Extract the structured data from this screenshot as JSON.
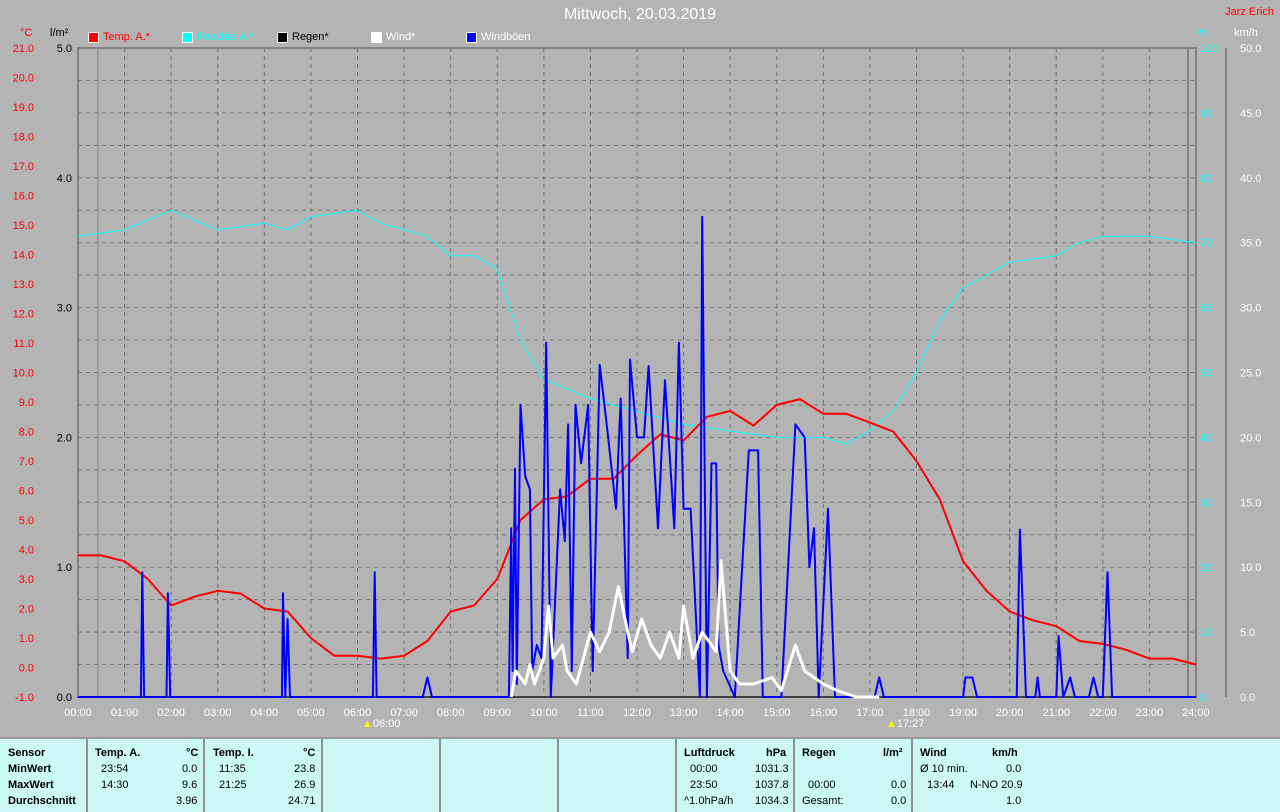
{
  "header": {
    "title": "Mittwoch, 20.03.2019",
    "owner": "Jarz Erich"
  },
  "legend": [
    {
      "label": "Temp. A.*",
      "color": "#ff0000"
    },
    {
      "label": "Feuchte A.*",
      "color": "#00ffff"
    },
    {
      "label": "Regen*",
      "color": "#000000"
    },
    {
      "label": "Wind*",
      "color": "#ffffff"
    },
    {
      "label": "Windböen",
      "color": "#0000ff"
    }
  ],
  "units": {
    "temp": "°C",
    "rain": "l/m²",
    "hum": "%",
    "wind": "km/h"
  },
  "sun": {
    "rise": "06:00",
    "set": "17:27"
  },
  "chart_data": {
    "type": "line",
    "title": "Mittwoch, 20.03.2019",
    "x_ticks": [
      "00:00",
      "01:00",
      "02:00",
      "03:00",
      "04:00",
      "05:00",
      "06:00",
      "07:00",
      "08:00",
      "09:00",
      "10:00",
      "11:00",
      "12:00",
      "13:00",
      "14:00",
      "15:00",
      "16:00",
      "17:00",
      "18:00",
      "19:00",
      "20:00",
      "21:00",
      "22:00",
      "23:00",
      "24:00"
    ],
    "xlim": [
      0,
      24
    ],
    "axes": {
      "temp": {
        "range": [
          -1,
          21
        ],
        "ticks": [
          "-1.0",
          "0.0",
          "1.0",
          "2.0",
          "3.0",
          "4.0",
          "5.0",
          "6.0",
          "7.0",
          "8.0",
          "9.0",
          "10.0",
          "11.0",
          "12.0",
          "13.0",
          "14.0",
          "15.0",
          "16.0",
          "17.0",
          "18.0",
          "19.0",
          "20.0",
          "21.0"
        ]
      },
      "rain": {
        "range": [
          0,
          5
        ],
        "ticks": [
          "0.0",
          "1.0",
          "2.0",
          "3.0",
          "4.0",
          "5.0"
        ]
      },
      "hum": {
        "range": [
          0,
          100
        ],
        "ticks": [
          "0",
          "10",
          "20",
          "30",
          "40",
          "50",
          "60",
          "70",
          "80",
          "90",
          "100"
        ]
      },
      "wind": {
        "range": [
          0,
          50
        ],
        "ticks": [
          "0.0",
          "5.0",
          "10.0",
          "15.0",
          "20.0",
          "25.0",
          "30.0",
          "35.0",
          "40.0",
          "45.0",
          "50.0"
        ]
      }
    },
    "series": [
      {
        "name": "Temp. A.",
        "axis": "temp",
        "color": "#ff0000",
        "width": 2,
        "points": [
          [
            0,
            3.8
          ],
          [
            0.5,
            3.8
          ],
          [
            1,
            3.6
          ],
          [
            1.5,
            3.0
          ],
          [
            2,
            2.1
          ],
          [
            2.5,
            2.4
          ],
          [
            3,
            2.6
          ],
          [
            3.5,
            2.5
          ],
          [
            4,
            2.0
          ],
          [
            4.5,
            1.9
          ],
          [
            5,
            1.0
          ],
          [
            5.5,
            0.4
          ],
          [
            6,
            0.4
          ],
          [
            6.5,
            0.3
          ],
          [
            7,
            0.4
          ],
          [
            7.5,
            0.9
          ],
          [
            8,
            1.9
          ],
          [
            8.5,
            2.1
          ],
          [
            9,
            3.0
          ],
          [
            9.5,
            5.0
          ],
          [
            10,
            5.7
          ],
          [
            10.5,
            5.8
          ],
          [
            11,
            6.4
          ],
          [
            11.5,
            6.4
          ],
          [
            12,
            7.2
          ],
          [
            12.5,
            7.9
          ],
          [
            13,
            7.7
          ],
          [
            13.5,
            8.5
          ],
          [
            14,
            8.7
          ],
          [
            14.5,
            8.2
          ],
          [
            15,
            8.9
          ],
          [
            15.5,
            9.1
          ],
          [
            16,
            8.6
          ],
          [
            16.5,
            8.6
          ],
          [
            17,
            8.3
          ],
          [
            17.5,
            8.0
          ],
          [
            18,
            7.0
          ],
          [
            18.5,
            5.7
          ],
          [
            19,
            3.6
          ],
          [
            19.5,
            2.6
          ],
          [
            20,
            1.9
          ],
          [
            20.5,
            1.6
          ],
          [
            21,
            1.4
          ],
          [
            21.5,
            0.9
          ],
          [
            22,
            0.8
          ],
          [
            22.5,
            0.6
          ],
          [
            23,
            0.3
          ],
          [
            23.5,
            0.3
          ],
          [
            24,
            0.1
          ]
        ]
      },
      {
        "name": "Feuchte A.",
        "axis": "hum",
        "color": "#00ffff",
        "width": 1,
        "points": [
          [
            0,
            71
          ],
          [
            1,
            72
          ],
          [
            2,
            75
          ],
          [
            3,
            72
          ],
          [
            4,
            73
          ],
          [
            4.5,
            72
          ],
          [
            5,
            74
          ],
          [
            6,
            75
          ],
          [
            6.5,
            73
          ],
          [
            7.5,
            71
          ],
          [
            8,
            68
          ],
          [
            8.5,
            68
          ],
          [
            9,
            66
          ],
          [
            9.5,
            55
          ],
          [
            10,
            49
          ],
          [
            11,
            46
          ],
          [
            12,
            44
          ],
          [
            13,
            42
          ],
          [
            14,
            41
          ],
          [
            15,
            40
          ],
          [
            16,
            40
          ],
          [
            16.5,
            39
          ],
          [
            17,
            41
          ],
          [
            17.5,
            44
          ],
          [
            18,
            50
          ],
          [
            18.5,
            58
          ],
          [
            19,
            63
          ],
          [
            20,
            67
          ],
          [
            21,
            68
          ],
          [
            21.5,
            70
          ],
          [
            22,
            71
          ],
          [
            23,
            71
          ],
          [
            24,
            70
          ]
        ]
      },
      {
        "name": "Regen",
        "axis": "rain",
        "color": "#000000",
        "width": 1,
        "points": [
          [
            0,
            0
          ],
          [
            24,
            0
          ]
        ]
      },
      {
        "name": "Windböen",
        "axis": "wind",
        "color": "#0000ff",
        "width": 2,
        "points": [
          [
            0,
            0
          ],
          [
            1.35,
            0
          ],
          [
            1.38,
            9.6
          ],
          [
            1.42,
            0
          ],
          [
            1.9,
            0
          ],
          [
            1.93,
            8
          ],
          [
            1.98,
            0
          ],
          [
            4.38,
            0
          ],
          [
            4.4,
            8
          ],
          [
            4.45,
            0
          ],
          [
            4.5,
            6
          ],
          [
            4.55,
            0
          ],
          [
            6.33,
            0
          ],
          [
            6.37,
            9.6
          ],
          [
            6.41,
            0
          ],
          [
            7.4,
            0
          ],
          [
            7.5,
            1.5
          ],
          [
            7.6,
            0
          ],
          [
            9.25,
            0
          ],
          [
            9.3,
            13
          ],
          [
            9.33,
            2
          ],
          [
            9.38,
            17.6
          ],
          [
            9.42,
            1
          ],
          [
            9.5,
            22.5
          ],
          [
            9.6,
            17
          ],
          [
            9.7,
            16
          ],
          [
            9.75,
            2
          ],
          [
            9.85,
            4
          ],
          [
            9.95,
            3
          ],
          [
            10.05,
            27.3
          ],
          [
            10.15,
            0
          ],
          [
            10.35,
            16
          ],
          [
            10.45,
            12
          ],
          [
            10.52,
            21
          ],
          [
            10.6,
            2
          ],
          [
            10.68,
            22.5
          ],
          [
            10.8,
            18
          ],
          [
            10.95,
            22.5
          ],
          [
            11.05,
            2
          ],
          [
            11.2,
            25.6
          ],
          [
            11.35,
            21
          ],
          [
            11.55,
            14.5
          ],
          [
            11.65,
            23
          ],
          [
            11.8,
            3
          ],
          [
            11.85,
            26
          ],
          [
            12.0,
            20
          ],
          [
            12.15,
            20
          ],
          [
            12.25,
            25.5
          ],
          [
            12.45,
            13
          ],
          [
            12.6,
            24.4
          ],
          [
            12.8,
            13
          ],
          [
            12.9,
            27.3
          ],
          [
            13.0,
            14.5
          ],
          [
            13.15,
            14.5
          ],
          [
            13.35,
            0
          ],
          [
            13.4,
            37
          ],
          [
            13.5,
            0
          ],
          [
            13.6,
            18
          ],
          [
            13.7,
            18
          ],
          [
            13.75,
            4
          ],
          [
            13.85,
            2
          ],
          [
            14.1,
            0
          ],
          [
            14.4,
            19
          ],
          [
            14.6,
            19
          ],
          [
            14.7,
            0
          ],
          [
            15.1,
            0
          ],
          [
            15.4,
            21
          ],
          [
            15.6,
            20
          ],
          [
            15.7,
            10
          ],
          [
            15.8,
            13
          ],
          [
            15.9,
            0
          ],
          [
            16.1,
            14.5
          ],
          [
            16.25,
            0
          ],
          [
            17.1,
            0
          ],
          [
            17.2,
            1.5
          ],
          [
            17.3,
            0
          ],
          [
            19.0,
            0
          ],
          [
            19.05,
            1.5
          ],
          [
            19.2,
            1.5
          ],
          [
            19.3,
            0
          ],
          [
            20.15,
            0
          ],
          [
            20.22,
            12.9
          ],
          [
            20.35,
            0
          ],
          [
            20.55,
            0
          ],
          [
            20.6,
            1.5
          ],
          [
            20.65,
            0
          ],
          [
            21.0,
            0
          ],
          [
            21.05,
            4.7
          ],
          [
            21.15,
            0
          ],
          [
            21.3,
            1.5
          ],
          [
            21.4,
            0
          ],
          [
            21.7,
            0
          ],
          [
            21.8,
            1.5
          ],
          [
            21.9,
            0
          ],
          [
            22.0,
            0
          ],
          [
            22.1,
            9.6
          ],
          [
            22.2,
            0
          ],
          [
            24,
            0
          ]
        ]
      },
      {
        "name": "Wind",
        "axis": "wind",
        "color": "#ffffff",
        "width": 3,
        "points": [
          [
            9.3,
            0
          ],
          [
            9.4,
            2
          ],
          [
            9.6,
            1
          ],
          [
            9.7,
            2.5
          ],
          [
            9.8,
            1
          ],
          [
            10.0,
            3
          ],
          [
            10.1,
            7
          ],
          [
            10.2,
            3
          ],
          [
            10.4,
            4
          ],
          [
            10.5,
            2
          ],
          [
            10.7,
            1
          ],
          [
            11.0,
            5
          ],
          [
            11.2,
            3.5
          ],
          [
            11.4,
            5
          ],
          [
            11.6,
            8.5
          ],
          [
            11.8,
            5
          ],
          [
            11.9,
            3.5
          ],
          [
            12.1,
            6
          ],
          [
            12.3,
            4
          ],
          [
            12.5,
            3
          ],
          [
            12.7,
            5
          ],
          [
            12.9,
            3
          ],
          [
            13.0,
            7
          ],
          [
            13.2,
            3
          ],
          [
            13.4,
            5
          ],
          [
            13.7,
            3.5
          ],
          [
            13.8,
            10.5
          ],
          [
            14.0,
            2
          ],
          [
            14.2,
            1
          ],
          [
            14.5,
            1
          ],
          [
            14.9,
            1.5
          ],
          [
            15.1,
            0.5
          ],
          [
            15.4,
            4
          ],
          [
            15.6,
            2
          ],
          [
            16.0,
            1
          ],
          [
            16.3,
            0.5
          ],
          [
            16.7,
            0
          ],
          [
            17.2,
            0
          ]
        ]
      }
    ]
  },
  "table": {
    "temp_a": {
      "header": "Temp. A.",
      "unit": "°C",
      "min_time": "23:54",
      "min": "0.0",
      "max_time": "14:30",
      "max": "9.6",
      "avg": "3.96"
    },
    "temp_i": {
      "header": "Temp. I.",
      "unit": "°C",
      "min_time": "11:35",
      "min": "23.8",
      "max_time": "21:25",
      "max": "26.9",
      "avg": "24.71"
    },
    "rows": {
      "sensor": "Sensor",
      "min": "MinWert",
      "max": "MaxWert",
      "avg": "Durchschnitt"
    },
    "pressure": {
      "header": "Luftdruck",
      "unit": "hPa",
      "r1_label": "00:00",
      "r1": "1031.3",
      "r2_label": "23:50",
      "r2": "1037.8",
      "r3_label": "^1.0hPa/h",
      "r3": "1034.3"
    },
    "rain": {
      "header": "Regen",
      "unit": "l/m²",
      "r2_label": "00:00",
      "r2": "0.0",
      "r3_label": "Gesamt:",
      "r3": "0.0"
    },
    "wind": {
      "header": "Wind",
      "unit": "km/h",
      "r1_label": "Ø 10 min.",
      "r1": "0.0",
      "r2_label": "13:44",
      "r2": "N-NO 20.9",
      "r3": "1.0"
    }
  }
}
